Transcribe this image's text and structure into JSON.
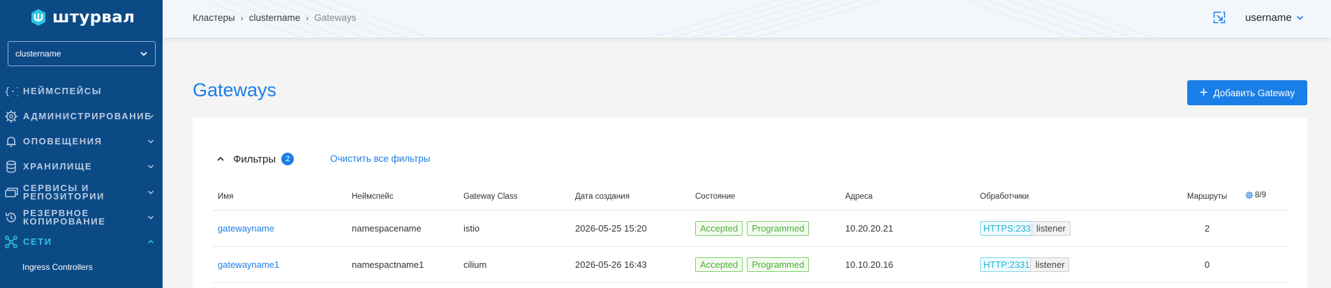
{
  "app": {
    "brand": "штурвал",
    "brand_color": "#0c4a86",
    "accent": "#1a7ee8",
    "active_color": "#2ec4e6"
  },
  "sidebar": {
    "cluster_select": {
      "value": "clustername",
      "icon": "chevron-down-icon"
    },
    "items": [
      {
        "label": "Неймспейсы",
        "icon": "braces-icon",
        "expandable": false,
        "active": false
      },
      {
        "label": "Администрирование",
        "icon": "gear-icon",
        "expandable": true,
        "active": false
      },
      {
        "label": "Оповещения",
        "icon": "bell-icon",
        "expandable": true,
        "active": false
      },
      {
        "label": "Хранилище",
        "icon": "database-icon",
        "expandable": true,
        "active": false
      },
      {
        "label": "Сервисы и репозитории",
        "label_line1": "Сервисы и",
        "label_line2": "репозитории",
        "icon": "services-icon",
        "expandable": true,
        "active": false
      },
      {
        "label": "Резервное копирование",
        "label_line1": "Резервное",
        "label_line2": "копирование",
        "icon": "backup-icon",
        "expandable": true,
        "active": false
      },
      {
        "label": "Сети",
        "icon": "network-icon",
        "expandable": true,
        "active": true
      }
    ],
    "subitems": [
      {
        "label": "Ingress Controllers"
      }
    ]
  },
  "header": {
    "breadcrumb": [
      "Кластеры",
      "clustername",
      "Gateways"
    ],
    "user": "username",
    "icons": [
      "expand-icon",
      "chevron-down-icon"
    ]
  },
  "main": {
    "title": "Gateways",
    "add_button": "Добавить Gateway",
    "filters": {
      "label": "Фильтры",
      "count": "2",
      "clear": "Очистить все фильтры"
    },
    "table": {
      "headers": {
        "name": "Имя",
        "namespace": "Неймспейс",
        "gateway_class": "Gateway Class",
        "created": "Дата создания",
        "state": "Состояние",
        "addresses": "Адреса",
        "listeners": "Обработчики",
        "routes": "Маршруты",
        "columns": "8/9"
      },
      "rows": [
        {
          "name": "gatewayname",
          "namespace": "namespacename",
          "gateway_class": "istio",
          "created": "2026-05-25 15:20",
          "state": [
            "Accepted",
            "Programmed"
          ],
          "address": "10.20.20.21",
          "listener_port": "HTTPS:233",
          "listener_name": "listener",
          "routes": "2"
        },
        {
          "name": "gatewayname1",
          "namespace": "namespactname1",
          "gateway_class": "cilium",
          "created": "2026-05-26 16:43",
          "state": [
            "Accepted",
            "Programmed"
          ],
          "address": "10.10.20.16",
          "listener_port": "HTTP:2331",
          "listener_name": "listener",
          "routes": "0"
        }
      ]
    }
  }
}
